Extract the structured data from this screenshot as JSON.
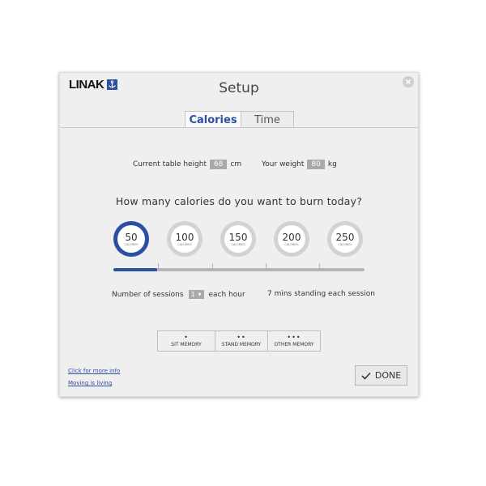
{
  "brand": {
    "name": "LINAK",
    "icon": "linak-anchor-icon"
  },
  "dialog": {
    "title": "Setup",
    "close_icon": "close-icon"
  },
  "tabs": [
    {
      "label": "Calories",
      "active": true
    },
    {
      "label": "Time",
      "active": false
    }
  ],
  "stats": {
    "height_label": "Current table height",
    "height_value": "68",
    "height_unit": "cm",
    "weight_label": "Your weight",
    "weight_value": "80",
    "weight_unit": "kg"
  },
  "question": "How many calories do you want to burn today?",
  "calorie_options": [
    {
      "value": "50",
      "unit": "CALORIES",
      "selected": true
    },
    {
      "value": "100",
      "unit": "CALORIES",
      "selected": false
    },
    {
      "value": "150",
      "unit": "CALORIES",
      "selected": false
    },
    {
      "value": "200",
      "unit": "CALORIES",
      "selected": false
    },
    {
      "value": "250",
      "unit": "CALORIES",
      "selected": false
    }
  ],
  "slider": {
    "level_fraction": 0.175
  },
  "sessions": {
    "label": "Number of sessions",
    "value": "1",
    "suffix": "each hour",
    "standing_text": "7 mins standing each session"
  },
  "memory_buttons": [
    {
      "dots": "•",
      "label": "SIT MEMORY"
    },
    {
      "dots": "••",
      "label": "STAND MEMORY"
    },
    {
      "dots": "•••",
      "label": "OTHER MEMORY"
    }
  ],
  "links": {
    "more_info": "Click for more info",
    "moving": "Moving is living"
  },
  "done": {
    "label": "DONE",
    "icon": "checkmark-icon"
  },
  "colors": {
    "accent": "#2b4fa3",
    "dialog_bg": "#efefef",
    "value_box": "#a9a9a9"
  }
}
